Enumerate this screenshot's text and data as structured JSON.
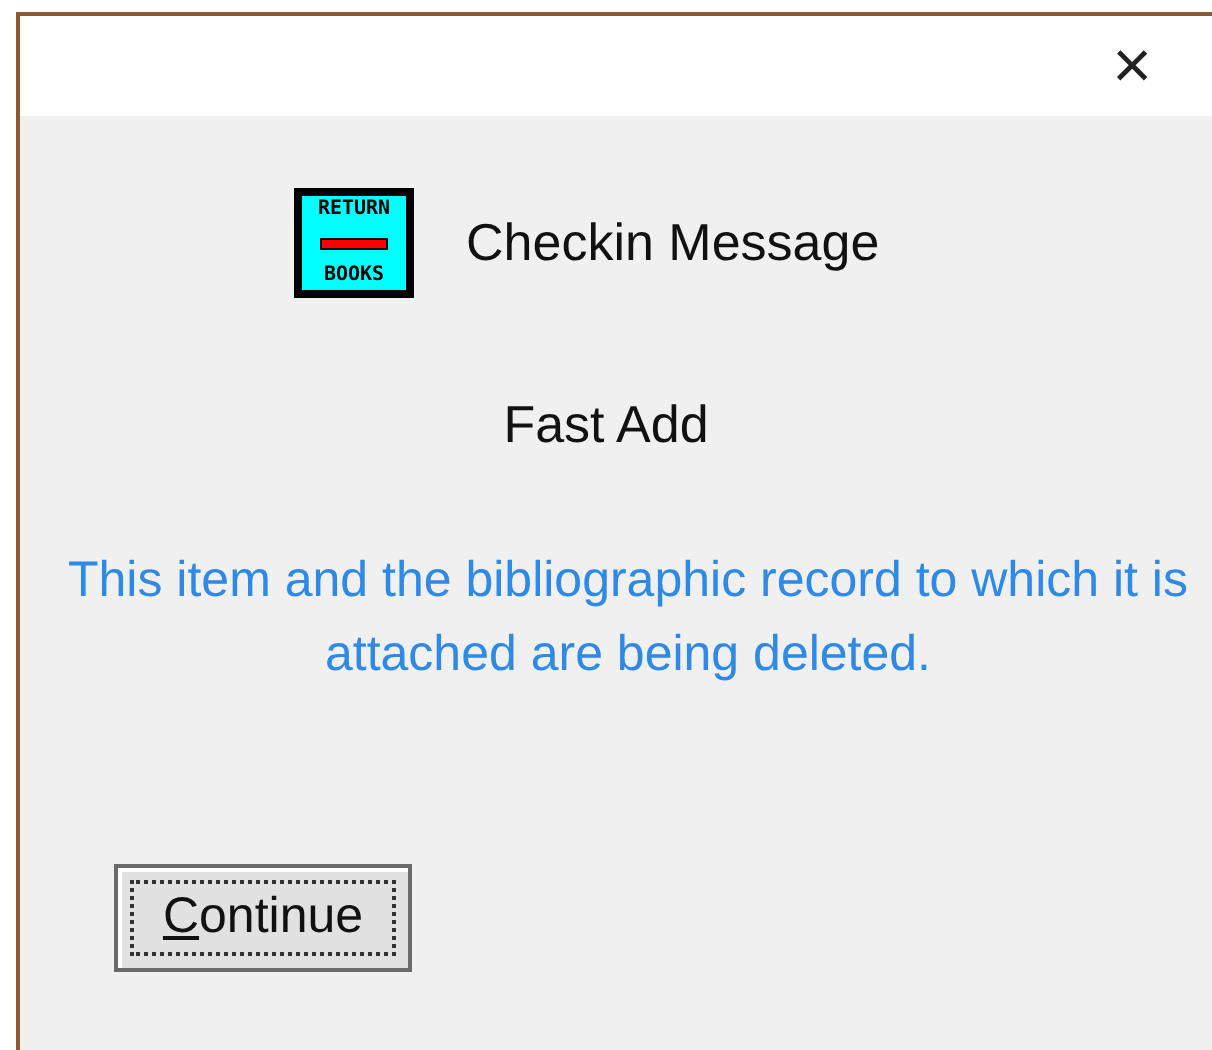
{
  "window": {
    "close": "×"
  },
  "icon": {
    "top_text": "RETURN",
    "bottom_text": "BOOKS"
  },
  "title": "Checkin Message",
  "subtitle": "Fast Add",
  "message": "This item and the bibliographic record to which it is attached are being deleted.",
  "button": {
    "mnemonic": "C",
    "rest": "ontinue"
  }
}
